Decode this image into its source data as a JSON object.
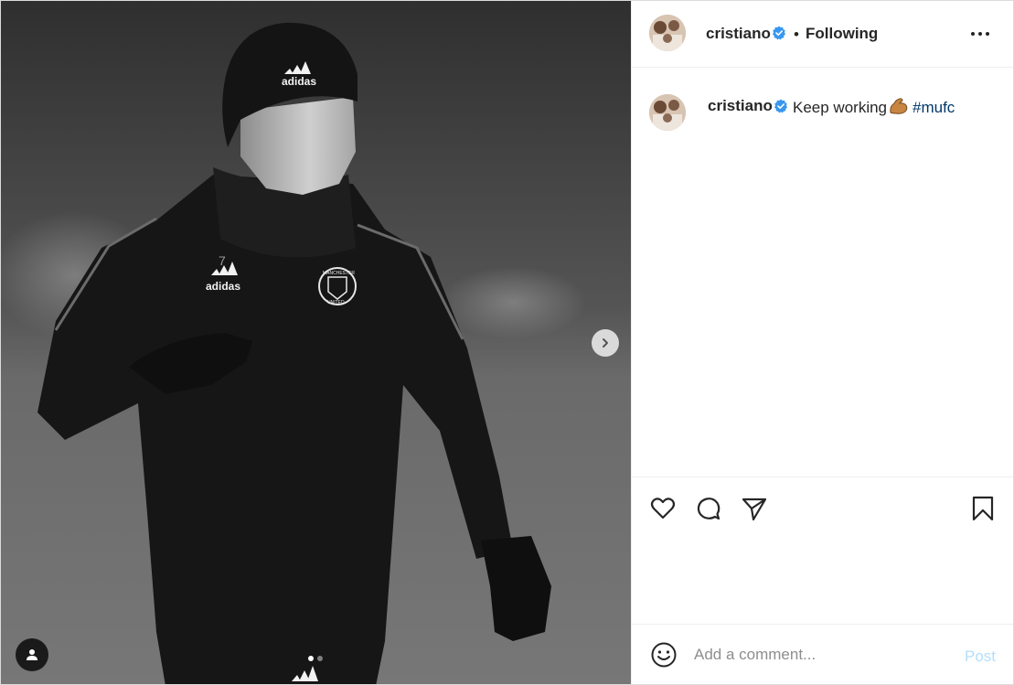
{
  "post": {
    "author": {
      "username": "cristiano",
      "verified": true,
      "follow_status": "Following",
      "separator": "•"
    },
    "caption": {
      "username": "cristiano",
      "text": "Keep working",
      "emoji": "flexed-biceps",
      "hashtag": "#mufc"
    },
    "media": {
      "kit": {
        "brand": "adidas",
        "number": "7",
        "crest_top": "MANCHESTER",
        "crest_bottom": "UNITED"
      },
      "carousel": {
        "current": 1,
        "total": 2
      }
    },
    "comment": {
      "placeholder": "Add a comment...",
      "post_label": "Post"
    },
    "icons": {
      "next": "chevron-right-icon",
      "tag": "user-tag-icon",
      "more": "more-options-icon",
      "like": "heart-icon",
      "comment": "comment-icon",
      "share": "paper-plane-icon",
      "save": "bookmark-icon",
      "emoji": "smiley-icon"
    },
    "colors": {
      "verified": "#3897f0",
      "hashtag": "#00376b",
      "post_disabled": "#b2dffc",
      "text": "#262626",
      "placeholder": "#8e8e8e"
    }
  }
}
